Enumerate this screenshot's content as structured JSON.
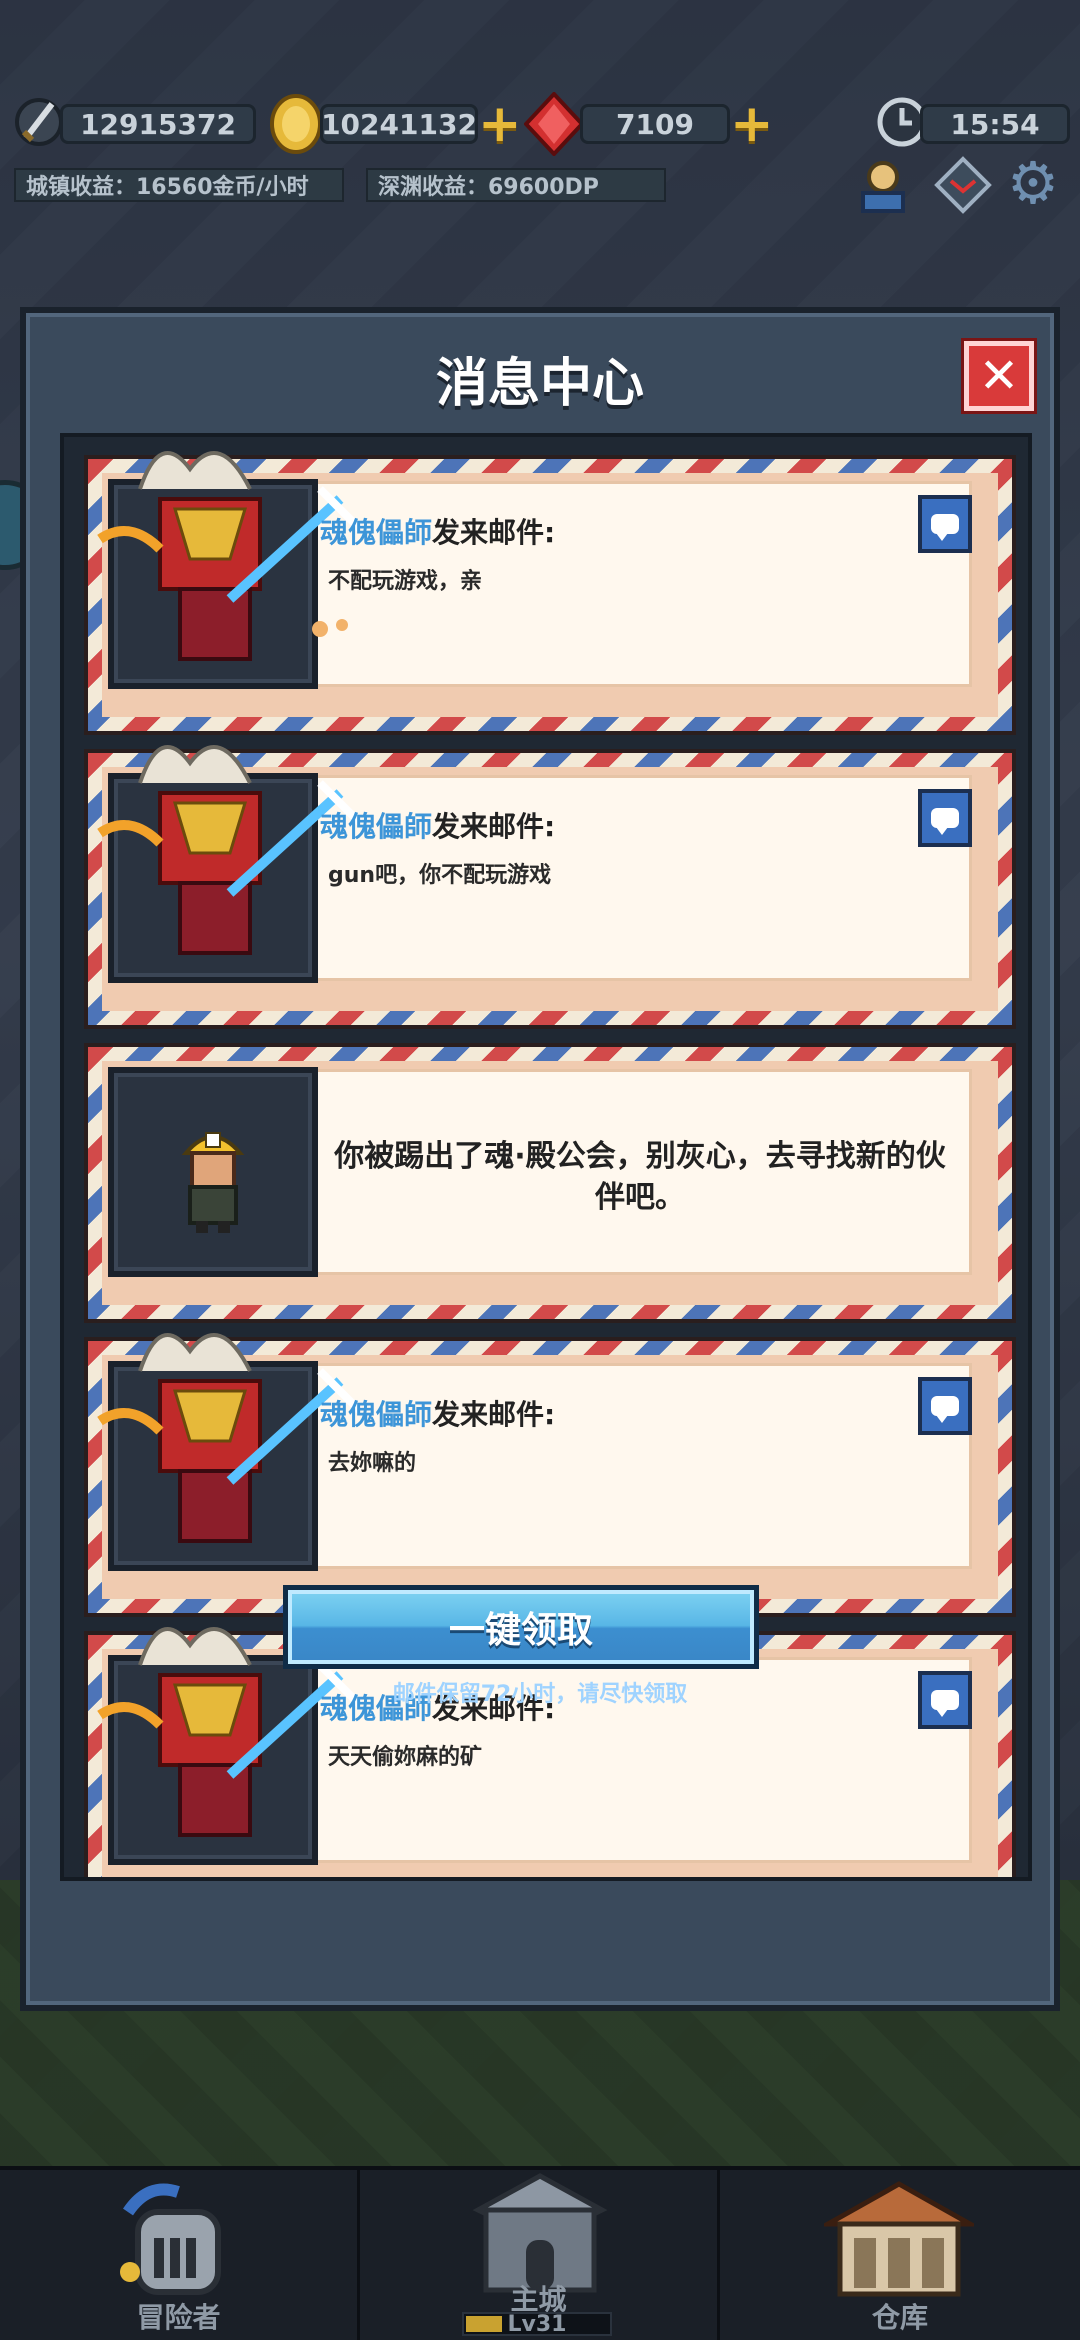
{
  "hud": {
    "resource1": "12915372",
    "gold": "10241132",
    "gems": "7109",
    "time": "15:54",
    "town_income": "城镇收益：16560金币/小时",
    "abyss_income": "深渊收益：69600DP"
  },
  "modal": {
    "title": "消息中心",
    "claim_all": "一键领取",
    "note": "邮件保留72小时，请尽快领取"
  },
  "mails": [
    {
      "sender": "魂傀儡師",
      "suffix": "发来邮件:",
      "body": "不配玩游戏，亲"
    },
    {
      "sender": "魂傀儡師",
      "suffix": "发来邮件:",
      "body": "gun吧，你不配玩游戏"
    },
    {
      "system": "你被踢出了魂·殿公会，别灰心，去寻找新的伙伴吧。"
    },
    {
      "sender": "魂傀儡師",
      "suffix": "发来邮件:",
      "body": "去妳嘛的"
    },
    {
      "sender": "魂傀儡師",
      "suffix": "发来邮件:",
      "body": "天天偷妳麻的矿"
    }
  ],
  "nav": {
    "adventurer": "冒险者",
    "main_city": "主城",
    "level": "Lv31",
    "warehouse": "仓库"
  },
  "colors": {
    "accent": "#3d95d8",
    "close": "#d93a3a",
    "claim": "#58b6e6",
    "gold": "#e6b93a"
  }
}
